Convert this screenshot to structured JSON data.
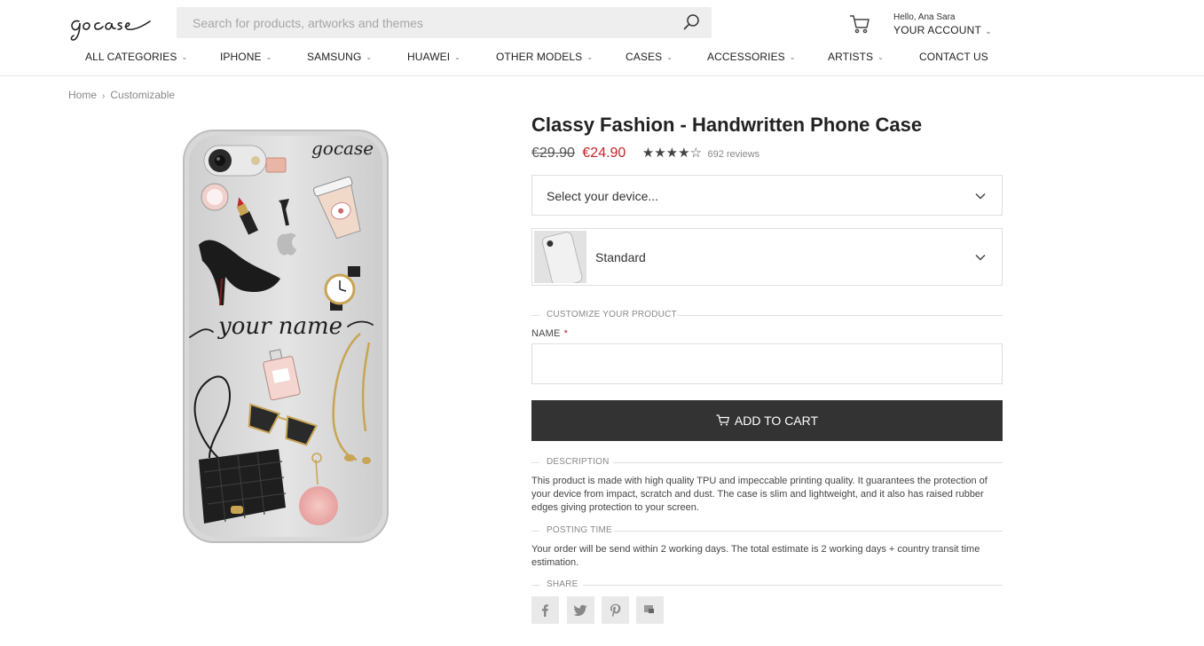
{
  "header": {
    "logo_text": "gocase",
    "search_placeholder": "Search for products, artworks and themes",
    "account_greeting": "Hello, Ana Sara",
    "account_label": "YOUR ACCOUNT"
  },
  "nav": {
    "items": [
      {
        "label": "ALL CATEGORIES",
        "has_dropdown": true
      },
      {
        "label": "IPHONE",
        "has_dropdown": true
      },
      {
        "label": "SAMSUNG",
        "has_dropdown": true
      },
      {
        "label": "HUAWEI",
        "has_dropdown": true
      },
      {
        "label": "OTHER MODELS",
        "has_dropdown": true
      },
      {
        "label": "CASES",
        "has_dropdown": true
      },
      {
        "label": "ACCESSORIES",
        "has_dropdown": true
      },
      {
        "label": "ARTISTS",
        "has_dropdown": true
      },
      {
        "label": "CONTACT US",
        "has_dropdown": false
      }
    ]
  },
  "breadcrumb": {
    "items": [
      "Home",
      "Customizable"
    ],
    "separator": "›"
  },
  "product": {
    "title": "Classy Fashion - Handwritten Phone Case",
    "old_price": "€29.90",
    "new_price": "€24.90",
    "rating": 4.5,
    "rating_stars": "★★★★☆",
    "reviews": "692 reviews",
    "image_brand_text": "gocase",
    "image_name_text": "your name",
    "device_select_placeholder": "Select your device...",
    "case_type": "Standard",
    "customize_heading": "CUSTOMIZE YOUR PRODUCT",
    "name_label": "NAME",
    "required_marker": "*",
    "name_value": "",
    "add_to_cart_label": "ADD TO CART",
    "description_heading": "DESCRIPTION",
    "description_text": "This product is made with high quality TPU and impeccable printing quality. It guarantees the protection of your device from impact, scratch and dust. The case is slim and lightweight, and it also has raised rubber edges giving protection to your screen.",
    "posting_heading": "POSTING TIME",
    "posting_text": "Your order will be send within 2 working days. The total estimate is 2 working days + country transit time estimation.",
    "share_heading": "SHARE",
    "share_buttons": [
      "facebook",
      "twitter",
      "pinterest",
      "tumblr"
    ]
  },
  "colors": {
    "sale_price": "#c0262c",
    "button_bg": "#333333",
    "search_bg": "#eeeeee"
  }
}
